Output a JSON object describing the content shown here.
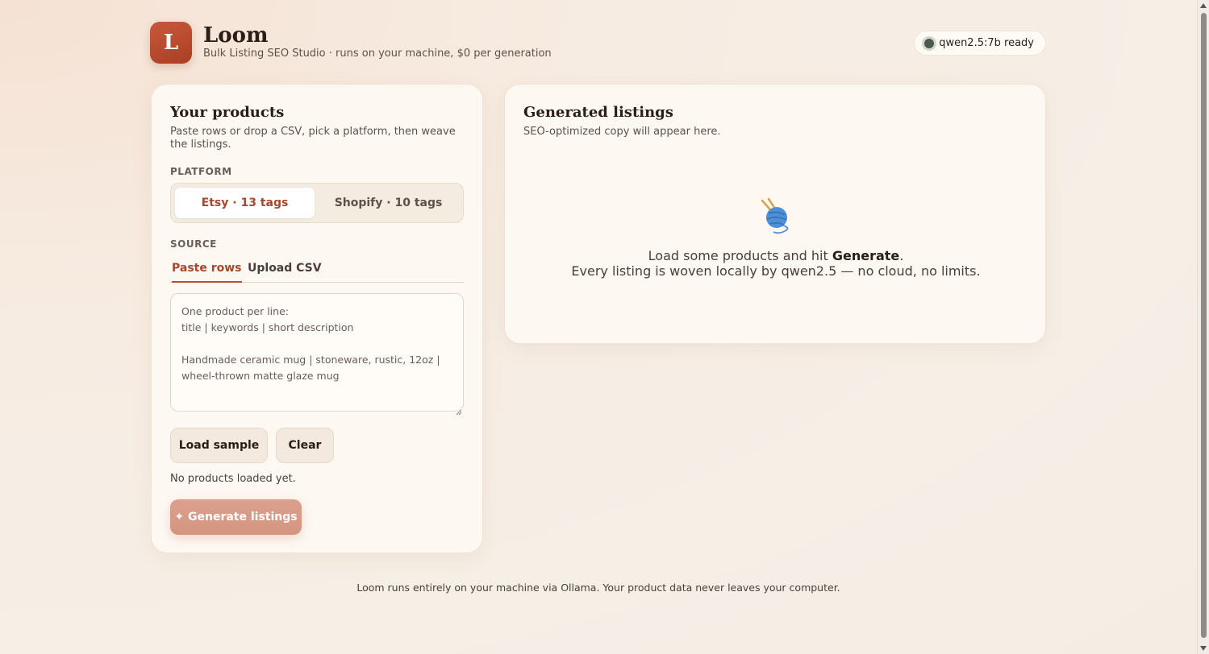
{
  "brand": {
    "logo_letter": "L",
    "title": "Loom",
    "subtitle": "Bulk Listing SEO Studio · runs on your machine, $0 per generation"
  },
  "status": {
    "label": "qwen2.5:7b ready",
    "color": "#4b5a4a"
  },
  "products_panel": {
    "title": "Your products",
    "description": "Paste rows or drop a CSV, pick a platform, then weave the listings.",
    "platform_label": "PLATFORM",
    "platforms": [
      {
        "label": "Etsy · 13 tags",
        "selected": true
      },
      {
        "label": "Shopify · 10 tags",
        "selected": false
      }
    ],
    "source_label": "SOURCE",
    "source_tabs": [
      {
        "label": "Paste rows",
        "selected": true
      },
      {
        "label": "Upload CSV",
        "selected": false
      }
    ],
    "textarea_placeholder": "One product per line:\ntitle | keywords | short description\n\nHandmade ceramic mug | stoneware, rustic, 12oz | wheel-thrown matte glaze mug",
    "load_sample_label": "Load sample",
    "clear_label": "Clear",
    "status_text": "No products loaded yet.",
    "generate_label": "✦ Generate listings"
  },
  "listings_panel": {
    "title": "Generated listings",
    "description": "SEO-optimized copy will appear here.",
    "empty_icon": "yarn-ball-icon",
    "empty_line1_prefix": "Load some products and hit ",
    "empty_line1_bold": "Generate",
    "empty_line1_suffix": ".",
    "empty_line2": "Every listing is woven locally by qwen2.5 — no cloud, no limits."
  },
  "footer": {
    "text": "Loom runs entirely on your machine via Ollama. Your product data never leaves your computer."
  },
  "colors": {
    "accent": "#a9452b",
    "logo_bg": "#c9583a",
    "generate_bg": "#d9a08c"
  }
}
